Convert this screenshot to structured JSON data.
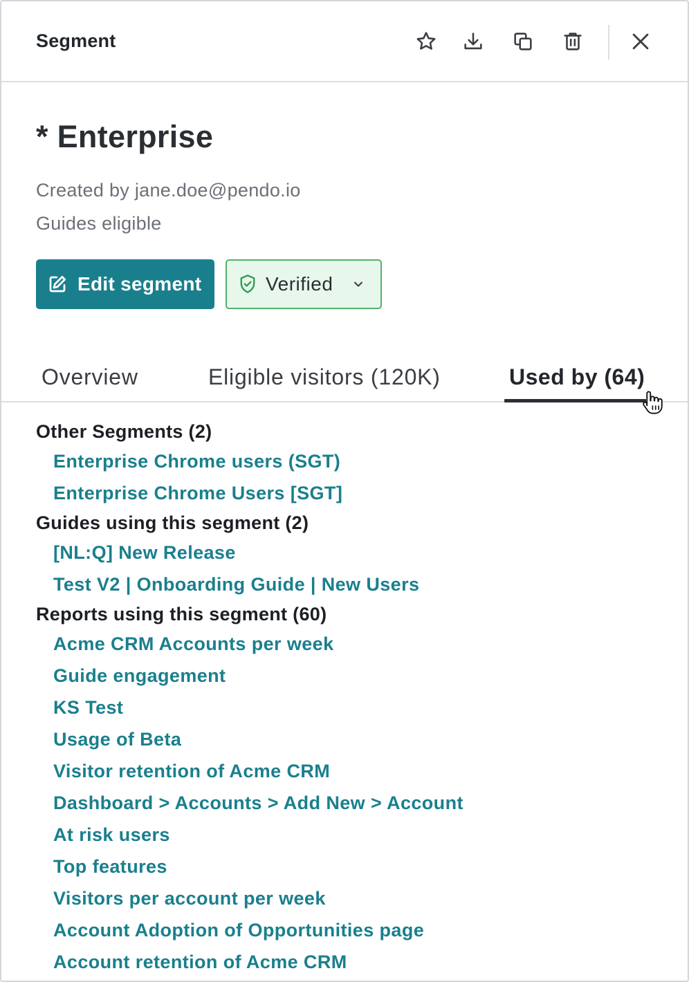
{
  "header": {
    "title": "Segment",
    "icons": [
      "star-icon",
      "download-icon",
      "copy-icon",
      "trash-icon",
      "close-icon"
    ]
  },
  "segment": {
    "name": "* Enterprise",
    "created_by": "Created by jane.doe@pendo.io",
    "eligibility": "Guides eligible"
  },
  "actions": {
    "edit_label": "Edit segment",
    "verified_label": "Verified"
  },
  "tabs": [
    {
      "label": "Overview"
    },
    {
      "label": "Eligible visitors (120K)"
    },
    {
      "label": "Used by (64)"
    }
  ],
  "sections": {
    "other_segments": {
      "title": "Other Segments (2)",
      "items": [
        "Enterprise Chrome users (SGT)",
        "Enterprise Chrome Users [SGT]"
      ]
    },
    "guides": {
      "title": "Guides using this segment (2)",
      "items": [
        "[NL:Q] New Release",
        "Test V2 | Onboarding Guide | New Users"
      ]
    },
    "reports": {
      "title": "Reports using this segment (60)",
      "items": [
        "Acme CRM Accounts per week",
        "Guide engagement",
        "KS Test",
        "Usage of Beta",
        "Visitor retention of Acme CRM",
        "Dashboard > Accounts > Add New > Account",
        "At risk users",
        "Top features",
        "Visitors per account per week",
        "Account Adoption of Opportunities page",
        "Account retention of Acme CRM"
      ]
    }
  },
  "colors": {
    "accent": "#1a7f8d",
    "verified_bg": "#e7f7ec",
    "verified_border": "#54b06b"
  }
}
